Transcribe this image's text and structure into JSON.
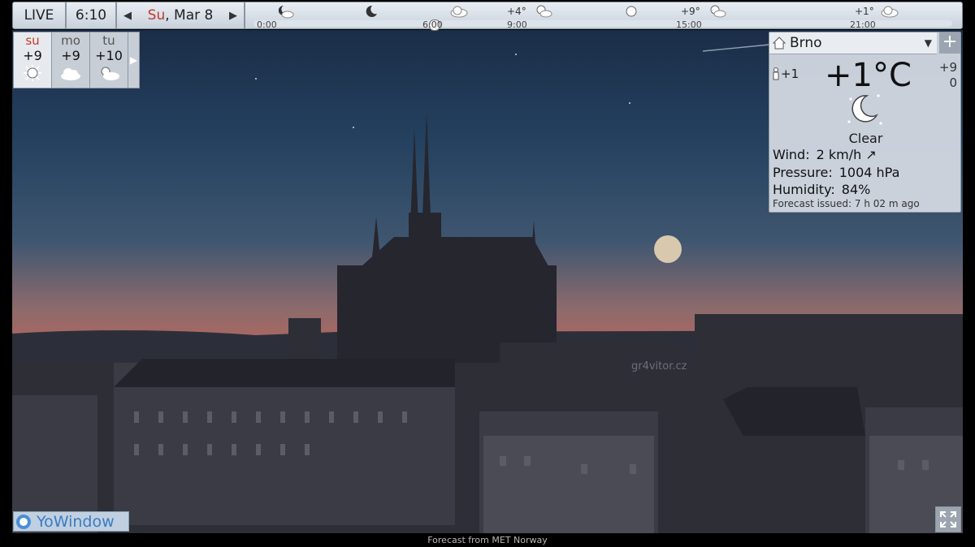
{
  "topbar": {
    "live_label": "LIVE",
    "time": "6:10",
    "date_day": "Su",
    "date_rest": ", Mar 8",
    "timeline": {
      "hours": [
        "0:00",
        "6:00",
        "9:00",
        "15:00",
        "21:00"
      ],
      "temps": [
        "+4°",
        "+9°",
        "+1°"
      ],
      "current_fraction": 0.26
    }
  },
  "daily": {
    "days": [
      {
        "name": "su",
        "temp": "+9",
        "icon": "sun-icon"
      },
      {
        "name": "mo",
        "temp": "+9",
        "icon": "cloud-icon"
      },
      {
        "name": "tu",
        "temp": "+10",
        "icon": "partly-cloudy-icon"
      }
    ]
  },
  "current": {
    "location": "Brno",
    "feels_like": "+1",
    "temperature": "+1°C",
    "side_high": "+9",
    "side_low": "0",
    "condition": "Clear",
    "wind_label": "Wind:",
    "wind_value": "2 km/h",
    "pressure_label": "Pressure:",
    "pressure_value": "1004 hPa",
    "humidity_label": "Humidity:",
    "humidity_value": "84%",
    "issued_label": "Forecast issued:",
    "issued_value": "7 h 02 m ago"
  },
  "scene": {
    "watermark": "gr4vitor.cz"
  },
  "branding": {
    "app_name": "YoWindow"
  },
  "footer": "Forecast from MET Norway"
}
